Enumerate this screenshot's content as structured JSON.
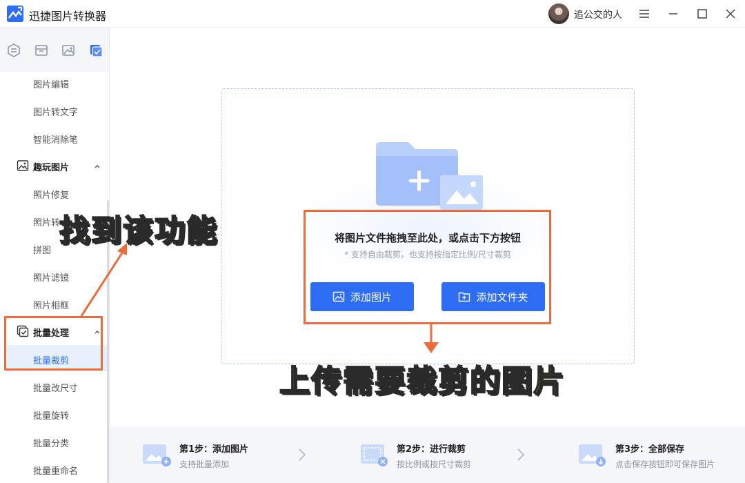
{
  "app": {
    "title": "迅捷图片转换器",
    "user_name": "追公交的人"
  },
  "sidebar": {
    "tool_icons": [
      "convert-icon",
      "compress-icon",
      "image-edit-icon",
      "batch-icon"
    ],
    "items_top": [
      {
        "label": "图片编辑"
      },
      {
        "label": "图片转文字"
      },
      {
        "label": "智能消除笔"
      }
    ],
    "group_fun": {
      "label": "趣玩图片",
      "expanded": true
    },
    "items_fun": [
      {
        "label": "照片修复"
      },
      {
        "label": "照片转"
      },
      {
        "label": "拼图"
      },
      {
        "label": "照片滤镜"
      },
      {
        "label": "照片相框"
      }
    ],
    "group_batch": {
      "label": "批量处理",
      "expanded": true
    },
    "items_batch": [
      {
        "label": "批量裁剪",
        "active": true
      },
      {
        "label": "批量改尺寸"
      },
      {
        "label": "批量旋转"
      },
      {
        "label": "批量分类"
      },
      {
        "label": "批量重命名"
      }
    ]
  },
  "main": {
    "drop_title": "将图片文件拖拽至此处，或点击下方按钮",
    "drop_subtitle": "* 支持自由裁剪，也支持按指定比例/尺寸裁剪",
    "add_image_label": "添加图片",
    "add_folder_label": "添加文件夹"
  },
  "steps": [
    {
      "title": "第1步：添加图片",
      "desc": "支持批量添加"
    },
    {
      "title": "第2步：进行裁剪",
      "desc": "按比例或按尺寸裁剪"
    },
    {
      "title": "第3步：全部保存",
      "desc": "点击保存按钮即可保存图片"
    }
  ],
  "annotations": {
    "find_feature": "找到该功能",
    "upload_hint": "上传需要裁剪的图片"
  },
  "colors": {
    "accent": "#2d6df6",
    "annotation_orange": "#ec6c3c",
    "annotation_yellow": "#ffd21f"
  }
}
